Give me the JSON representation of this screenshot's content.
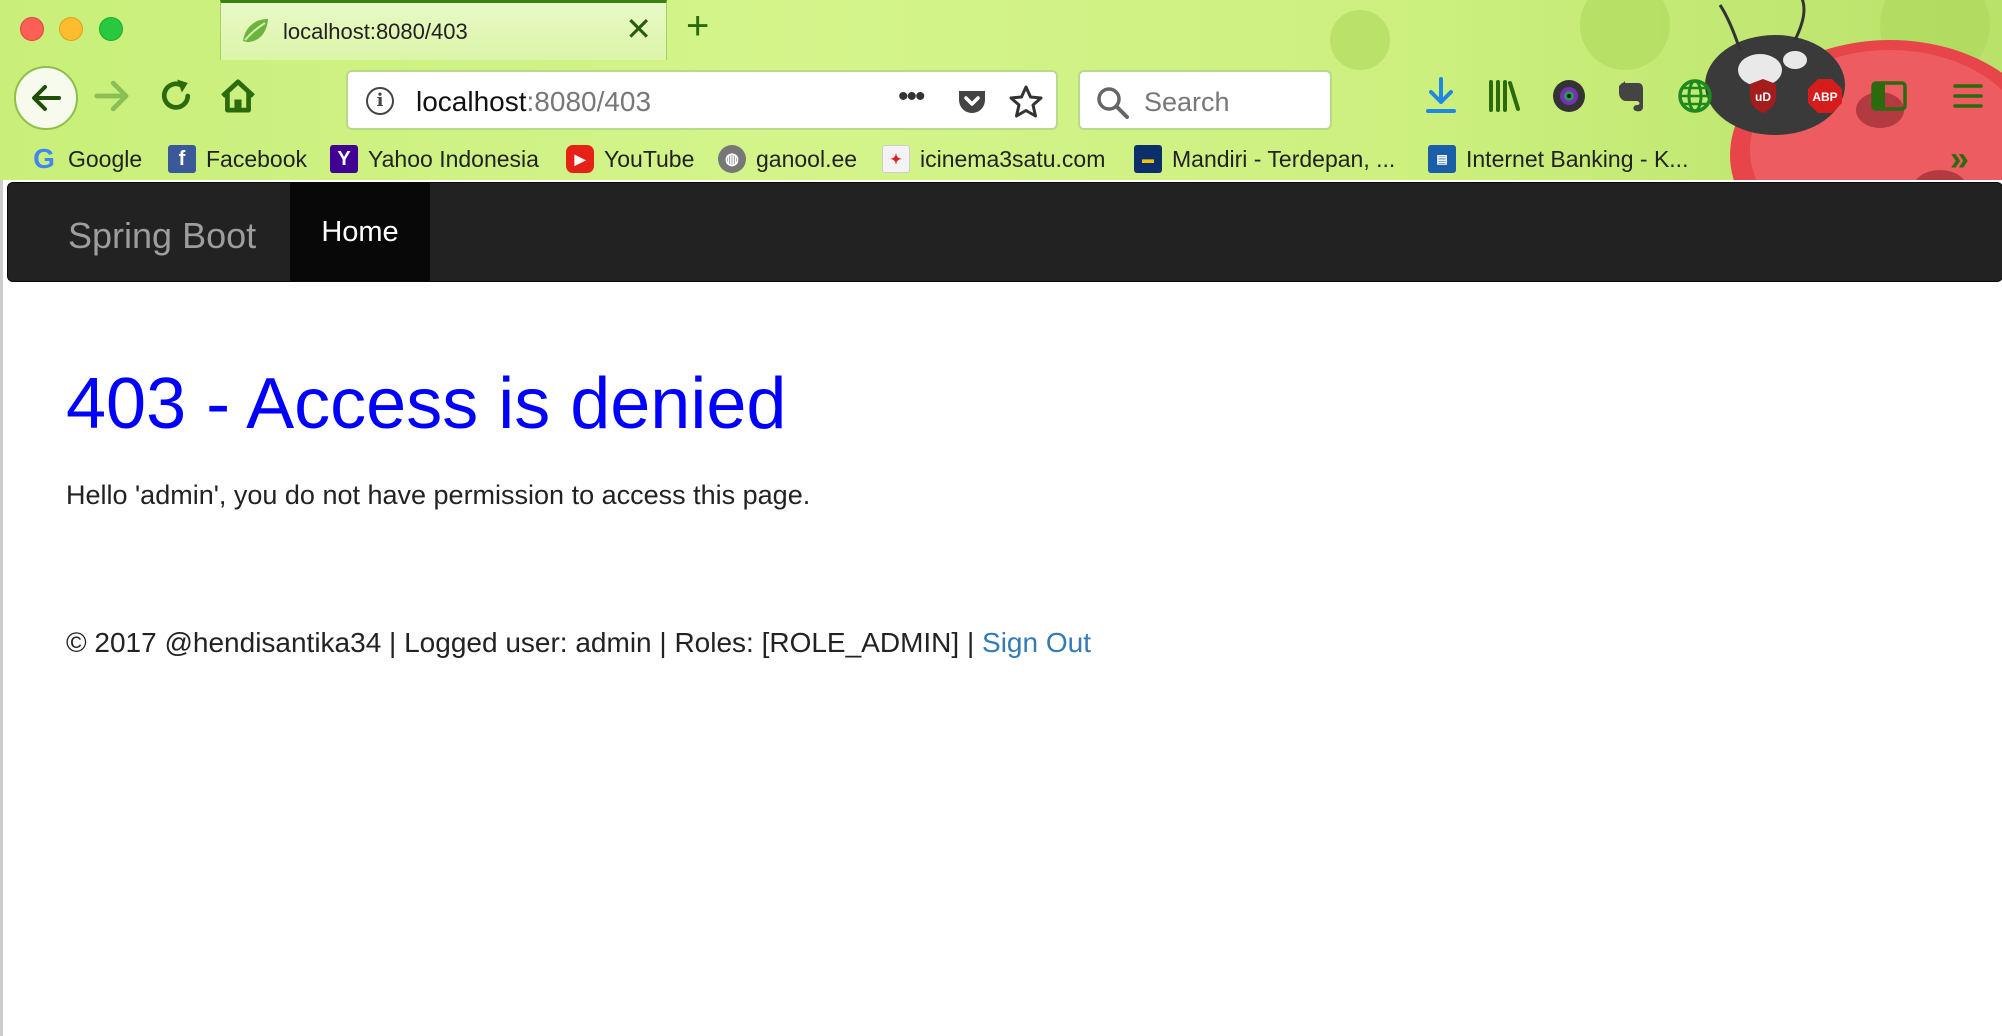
{
  "browser": {
    "tab": {
      "title": "localhost:8080/403"
    },
    "url": {
      "host": "localhost",
      "rest": ":8080/403"
    },
    "search": {
      "placeholder": "Search"
    },
    "bookmarks": [
      {
        "label": "Google",
        "icon": "google-icon"
      },
      {
        "label": "Facebook",
        "icon": "facebook-icon"
      },
      {
        "label": "Yahoo Indonesia",
        "icon": "yahoo-icon"
      },
      {
        "label": "YouTube",
        "icon": "youtube-icon"
      },
      {
        "label": "ganool.ee",
        "icon": "globe-icon"
      },
      {
        "label": "icinema3satu.com",
        "icon": "icinema-icon"
      },
      {
        "label": "Mandiri - Terdepan, ...",
        "icon": "mandiri-icon"
      },
      {
        "label": "Internet Banking - K...",
        "icon": "bank-icon"
      }
    ],
    "toolbar_icons": [
      "download-icon",
      "library-icon",
      "camera-icon",
      "evernote-icon",
      "globe-icon",
      "ublock-icon",
      "adblock-plus-icon",
      "sidebar-icon",
      "menu-icon"
    ],
    "extension_labels": {
      "ublock": "uD",
      "abp": "ABP"
    },
    "colors": {
      "chrome": "#cdf07f",
      "accent": "#2b6a0d"
    }
  },
  "page": {
    "navbar": {
      "brand": "Spring Boot",
      "home": "Home"
    },
    "heading": "403 - Access is denied",
    "message": "Hello 'admin', you do not have permission to access this page.",
    "footer": {
      "text": "© 2017 @hendisantika34 | Logged user: admin | Roles: [ROLE_ADMIN] | ",
      "signout": "Sign Out"
    },
    "colors": {
      "heading": "#0000ff",
      "navbar": "#222222",
      "link": "#337ab7"
    }
  }
}
